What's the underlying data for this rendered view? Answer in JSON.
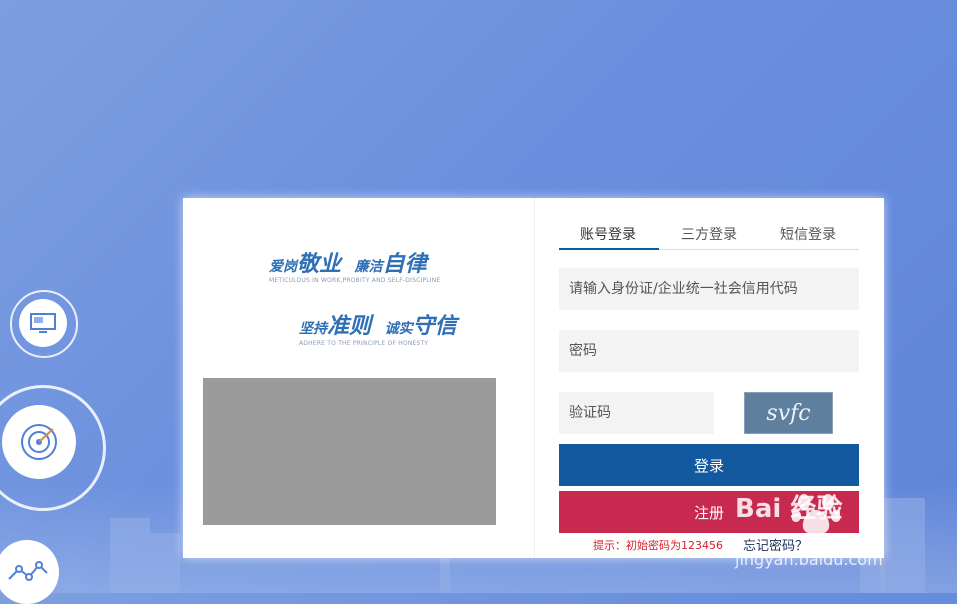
{
  "left_panel": {
    "slogan1": {
      "part1": "爱岗",
      "part2": "敬业",
      "part3": "廉洁",
      "part4": "自律",
      "sub": "METICULOUS IN WORK,PROBITY AND SELF-DISCIPLINE"
    },
    "slogan2": {
      "part1": "坚持",
      "part2": "准则",
      "part3": "诚实",
      "part4": "守信",
      "sub": "ADHERE TO THE PRINCIPLE OF HONESTY"
    }
  },
  "tabs": [
    {
      "label": "账号登录",
      "active": true
    },
    {
      "label": "三方登录",
      "active": false
    },
    {
      "label": "短信登录",
      "active": false
    }
  ],
  "form": {
    "id_placeholder": "请输入身份证/企业统一社会信用代码",
    "password_placeholder": "密码",
    "captcha_placeholder": "验证码",
    "captcha_text": "svfc",
    "login_label": "登录",
    "register_label": "注册",
    "hint": "提示：初始密码为123456",
    "forgot": "忘记密码？"
  },
  "watermark": {
    "brand": "Bai 经验",
    "url": "jingyan.baidu.com"
  },
  "colors": {
    "primary": "#1259a0",
    "register": "#c8294f",
    "hint": "#d4202a"
  },
  "icons": [
    "monitor-icon",
    "target-icon",
    "chart-line-icon",
    "baidu-paw-icon"
  ]
}
